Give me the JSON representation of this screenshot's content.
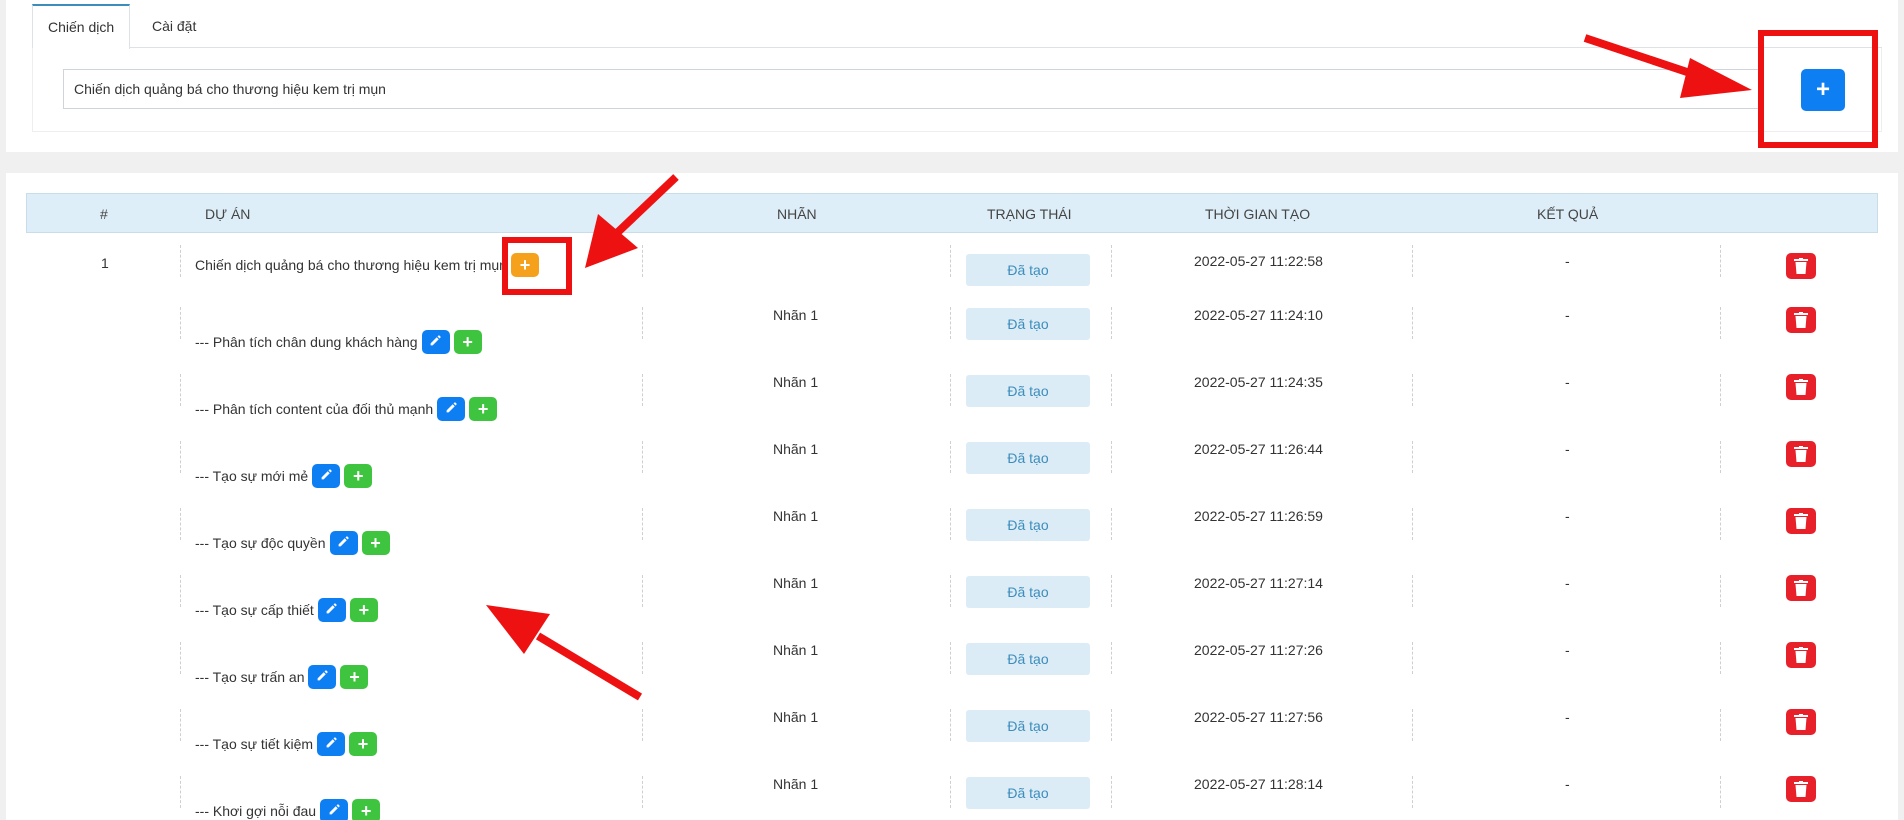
{
  "tabs": [
    {
      "label": "Chiến dịch",
      "active": true
    },
    {
      "label": "Cài đặt",
      "active": false
    }
  ],
  "campaign_input": {
    "value": "Chiến dịch quảng bá cho thương hiệu kem trị mụn"
  },
  "add_campaign_button": {
    "label": "+",
    "icon": "plus-icon"
  },
  "table": {
    "headers": {
      "index": "#",
      "project": "Dự án",
      "label": "Nhãn",
      "status": "Trạng thái",
      "created": "Thời gian tạo",
      "result": "Kết quả"
    },
    "rows": [
      {
        "index": "1",
        "project": "Chiến dịch quảng bá cho thương hiệu kem trị mụn",
        "label": "",
        "status": "Đã tạo",
        "created": "2022-05-27 11:22:58",
        "result": "-",
        "parent": true
      },
      {
        "index": "",
        "project": "--- Phân tích chân dung khách hàng",
        "label": "Nhãn 1",
        "status": "Đã tạo",
        "created": "2022-05-27 11:24:10",
        "result": "-"
      },
      {
        "index": "",
        "project": "--- Phân tích content của đối thủ mạnh",
        "label": "Nhãn 1",
        "status": "Đã tạo",
        "created": "2022-05-27 11:24:35",
        "result": "-"
      },
      {
        "index": "",
        "project": "--- Tạo sự mới mẻ",
        "label": "Nhãn 1",
        "status": "Đã tạo",
        "created": "2022-05-27 11:26:44",
        "result": "-"
      },
      {
        "index": "",
        "project": "--- Tạo sự độc quyền",
        "label": "Nhãn 1",
        "status": "Đã tạo",
        "created": "2022-05-27 11:26:59",
        "result": "-"
      },
      {
        "index": "",
        "project": "--- Tạo sự cấp thiết",
        "label": "Nhãn 1",
        "status": "Đã tạo",
        "created": "2022-05-27 11:27:14",
        "result": "-"
      },
      {
        "index": "",
        "project": "--- Tạo sự trấn an",
        "label": "Nhãn 1",
        "status": "Đã tạo",
        "created": "2022-05-27 11:27:26",
        "result": "-"
      },
      {
        "index": "",
        "project": "--- Tạo sự tiết kiệm",
        "label": "Nhãn 1",
        "status": "Đã tạo",
        "created": "2022-05-27 11:27:56",
        "result": "-"
      },
      {
        "index": "",
        "project": "--- Khơi gợi nỗi đau",
        "label": "Nhãn 1",
        "status": "Đã tạo",
        "created": "2022-05-27 11:28:14",
        "result": "-"
      }
    ]
  },
  "colors": {
    "primary": "#0d7ff2",
    "success": "#3ec43e",
    "warning": "#f5a11c",
    "danger": "#e8202a",
    "annotation": "#ee1111",
    "header_bg": "#ddeef8",
    "badge_bg": "#dcecf6"
  },
  "icons": {
    "edit": "pencil-icon",
    "add_child": "plus-icon",
    "delete": "trash-icon"
  }
}
